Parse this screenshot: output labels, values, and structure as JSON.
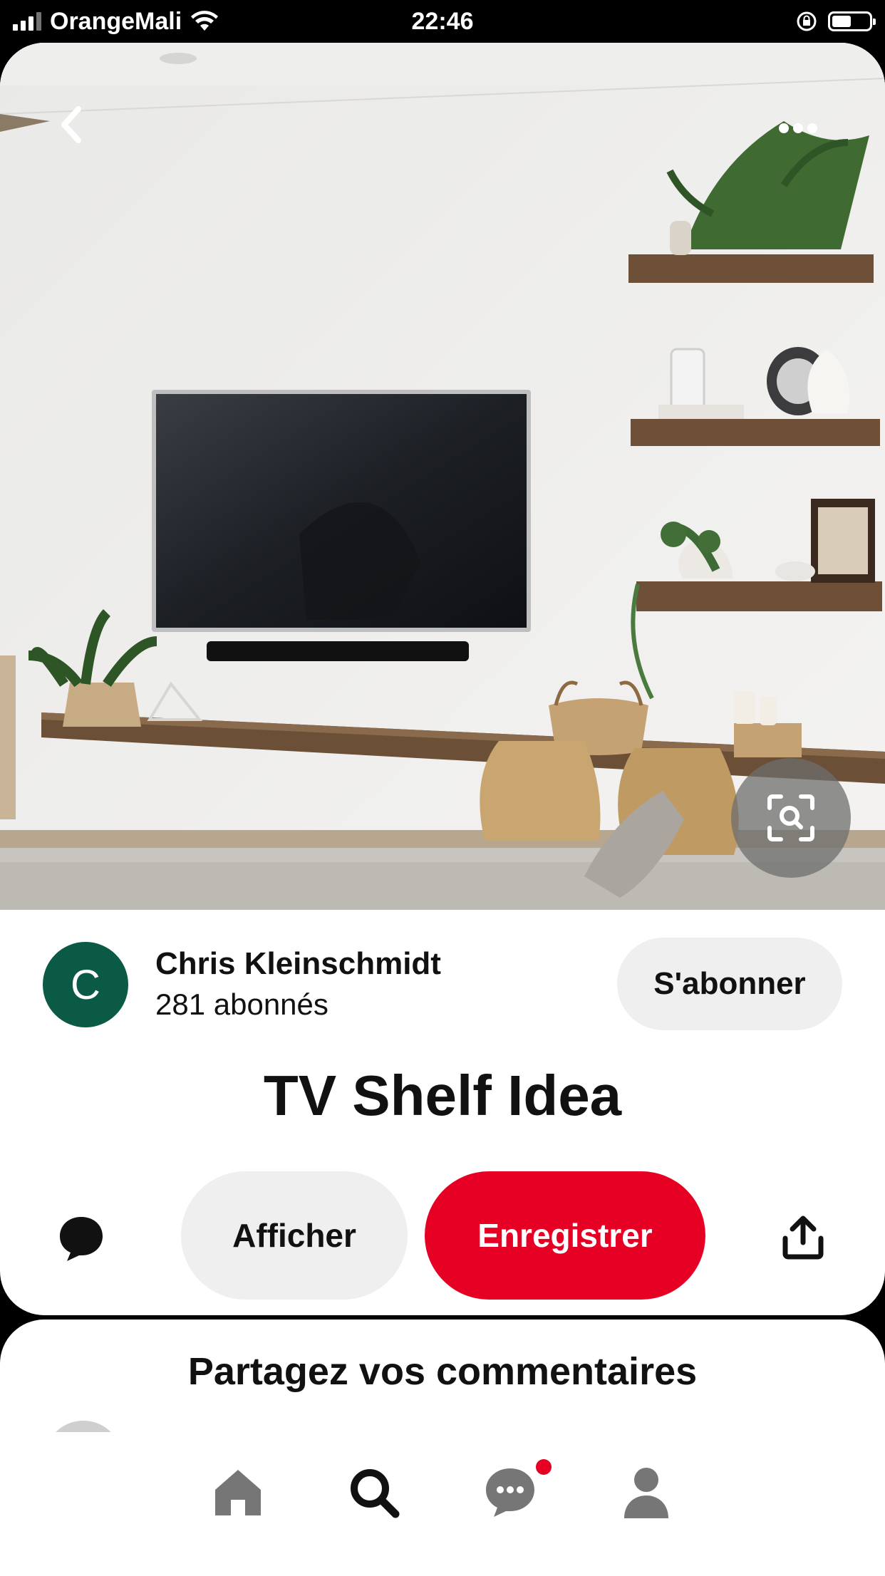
{
  "status_bar": {
    "carrier": "OrangeMali",
    "time": "22:46"
  },
  "pin": {
    "image_alt": "Living room wall with mounted TV, soundbar, wooden floating shelves, plants and woven baskets",
    "creator": {
      "avatar_letter": "C",
      "name": "Chris Kleinschmidt",
      "followers": "281 abonnés",
      "follow_label": "S'abonner",
      "avatar_color": "#0a5a45"
    },
    "title": "TV Shelf Idea",
    "actions": {
      "view_label": "Afficher",
      "save_label": "Enregistrer",
      "save_color": "#e60023"
    }
  },
  "comments": {
    "heading": "Partagez vos commentaires"
  },
  "tabbar": {
    "items": [
      "home-icon",
      "search-icon",
      "messages-icon",
      "profile-icon"
    ],
    "active": "search-icon",
    "notification_color": "#e60023"
  }
}
